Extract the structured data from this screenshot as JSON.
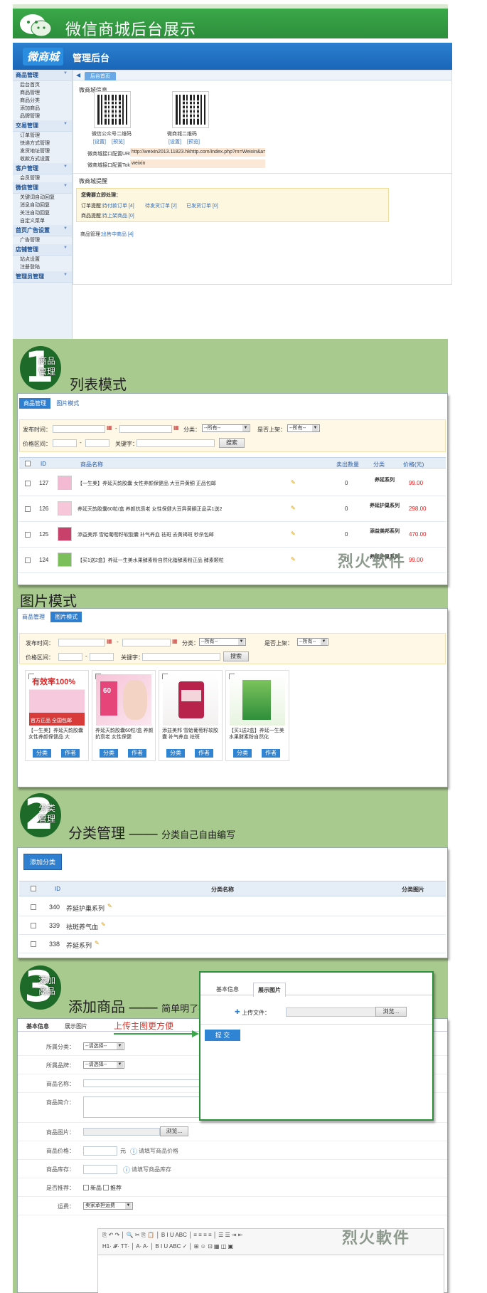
{
  "banner": {
    "title": "微信商城后台展示"
  },
  "admin": {
    "brand": "微商城",
    "subtitle": "管理后台",
    "tab": "后台首页",
    "sidebar": [
      {
        "group": "商品管理",
        "items": [
          "后台首页",
          "商品管理",
          "商品分类",
          "添加商品",
          "品牌管理"
        ]
      },
      {
        "group": "交易管理",
        "items": [
          "订单管理",
          "快递方式管理",
          "发货地址管理",
          "收款方式设置"
        ]
      },
      {
        "group": "客户管理",
        "items": [
          "会员管理"
        ]
      },
      {
        "group": "微信管理",
        "items": [
          "关键词自动回复",
          "消息自动回复",
          "关注自动回复",
          "自定义菜单"
        ]
      },
      {
        "group": "首页广告设置",
        "items": [
          "广告管理"
        ]
      },
      {
        "group": "店铺管理",
        "items": [
          "站点设置",
          "注册登陆"
        ]
      },
      {
        "group": "管理员管理",
        "items": []
      }
    ],
    "info_title": "微商城信息",
    "qr1_label": "微信公众号二维码",
    "qr2_label": "微商城二维码",
    "set_link": "[设置]",
    "preview_link": "[预览]",
    "url_label": "微商城接口配置URL：",
    "url_value": "http://weixin2013.11823.hkhttp.com/index.php?m=Weixin&a=ind",
    "token_label": "微商城接口配置Token：",
    "token_value": "weixin",
    "remind_title": "微商城提醒",
    "remind_head": "您需要立即处理：",
    "order_label": "订单提醒：",
    "order_links": [
      "待付款订单 [4]",
      "待发货订单 [2]",
      "已发货订单 [0]"
    ],
    "goods_label": "商品提醒：",
    "goods_link": "待上架商品 [0]",
    "mgmt_label": "商品管理：",
    "mgmt_link": "出售中商品 [4]"
  },
  "sec1": {
    "step": "1",
    "step_label": "商品 管理",
    "heading": "列表模式",
    "tabs": [
      "商品管理",
      "图片模式"
    ],
    "filter": {
      "date_label": "发布时间：",
      "dash": "-",
      "cat_label": "分类：",
      "cat_value": "--所有--",
      "shelf_label": "是否上架：",
      "shelf_value": "--所有--",
      "price_label": "价格区间：",
      "keyword_label": "关键字：",
      "search_btn": "搜索"
    },
    "columns": [
      "ID",
      "商品名称",
      "卖出数量",
      "分类",
      "价格(元)"
    ],
    "rows": [
      {
        "id": "127",
        "name": "【一生美】养延天韵胶囊 女性养颜保健品 大豆异黄酮 正品包邮",
        "sold": "0",
        "cat": "养延系列",
        "price": "99.00"
      },
      {
        "id": "126",
        "name": "养延天韵胶囊60粒/盒 养颜抗衰老 女性保健大豆异黄酮正品买1送2",
        "sold": "0",
        "cat": "养延护巢系列",
        "price": "298.00"
      },
      {
        "id": "125",
        "name": "添益美邦 雪蛤葡萄籽软胶囊 补气养血 祛斑 去黄褐斑 秒杀包邮",
        "sold": "0",
        "cat": "添益美邦系列",
        "price": "470.00"
      },
      {
        "id": "124",
        "name": "【买1送2盒】养延一生美水果酵素粉自然化脂酵素粉正品 酵素颗粒",
        "sold": "0",
        "cat": "养延护巢系列",
        "price": "99.00"
      }
    ],
    "watermark": "烈火软件"
  },
  "sec1b": {
    "heading": "图片模式",
    "tabs": [
      "商品管理",
      "图片模式"
    ],
    "cards": [
      {
        "img_text": "有效率100%",
        "badge": "官方正品 全国包邮",
        "caption": "【一生美】养延天韵胶囊 女性养颜保健品 大",
        "btn1": "分类",
        "btn2": "作者"
      },
      {
        "img_text": "60",
        "badge": "",
        "caption": "养延天韵胶囊60粒/盒 养颜抗衰老 女性保健",
        "btn1": "分类",
        "btn2": "作者"
      },
      {
        "img_text": "",
        "badge": "",
        "caption": "添益美邦 雪蛤葡萄籽软胶囊 补气养血 祛斑",
        "btn1": "分类",
        "btn2": "作者"
      },
      {
        "img_text": "",
        "badge": "",
        "caption": "【买1送2盒】养延一生美水果酵素粉自然化",
        "btn1": "分类",
        "btn2": "作者"
      }
    ]
  },
  "sec2": {
    "step": "2",
    "step_label": "分类 管理",
    "heading": "分类管理",
    "dash_line": "——",
    "sub": "分类自己自由编写",
    "add_btn": "添加分类",
    "columns": [
      "ID",
      "分类名称",
      "分类图片"
    ],
    "rows": [
      {
        "id": "340",
        "name": "养延护巢系列"
      },
      {
        "id": "339",
        "name": "祛斑养气血"
      },
      {
        "id": "338",
        "name": "养延系列"
      }
    ]
  },
  "sec3": {
    "step": "3",
    "step_label": "添加 商品",
    "heading": "添加商品",
    "dash_line": "——",
    "sub": "简单明了操作便捷",
    "callout": "上传主图更方便",
    "tabs": [
      "基本信息",
      "展示图片"
    ],
    "popup": {
      "tabs": [
        "基本信息",
        "展示图片"
      ],
      "upload_label": "上传文件：",
      "browse": "浏览...",
      "submit": "提 交"
    },
    "form": [
      {
        "label": "所属分类：",
        "type": "select",
        "value": "--请选择--"
      },
      {
        "label": "所属品牌：",
        "type": "select",
        "value": "--请选择--"
      },
      {
        "label": "商品名称：",
        "type": "input",
        "value": ""
      },
      {
        "label": "商品简介：",
        "type": "textarea",
        "value": ""
      },
      {
        "label": "商品图片：",
        "type": "file",
        "value": "浏览..."
      },
      {
        "label": "商品价格：",
        "type": "price",
        "value": "元",
        "hint": "请填写商品价格"
      },
      {
        "label": "商品库存：",
        "type": "stock",
        "value": "",
        "hint": "请填写商品库存"
      },
      {
        "label": "是否推荐：",
        "type": "check",
        "value": "新品",
        "value2": "推荐"
      },
      {
        "label": "运费：",
        "type": "select",
        "value": "卖家承担运费"
      }
    ],
    "editor_row1": "⎘ ↶ ↷ │ 🔍 ✂ ⎘ 📋 │ B I U ABC │ ≡ ≡ ≡ ≡ │ ☰ ☰ ⇥ ⇤",
    "editor_row2": "H1· 𝓕· TT· │ A· A· │ B I U ABC ✓ │ ⊞ ☺ ⊡ ▦ ◫ ▣",
    "watermark": "烈火軟件"
  },
  "colors": {
    "green": "#2d8e3b",
    "blue": "#2f7fd0",
    "red": "#e02020",
    "panelbg": "#a9ca8f"
  }
}
